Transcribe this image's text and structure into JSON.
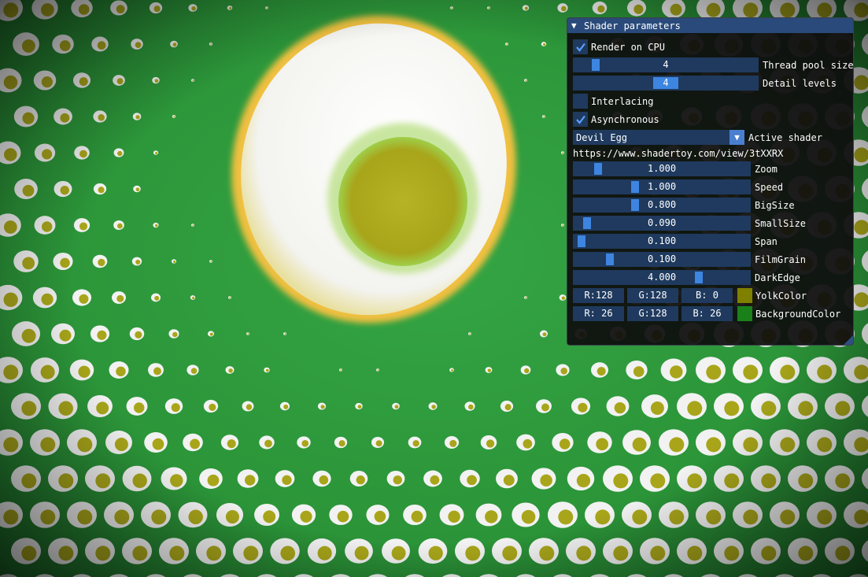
{
  "window": {
    "title": "Shader parameters",
    "collapse_icon": "triangle-down-icon"
  },
  "controls": {
    "render_cpu": {
      "label": "Render on CPU",
      "checked": true
    },
    "thread_pool": {
      "label": "Thread pool size",
      "value": "4",
      "fraction": 0.1
    },
    "detail_levels": {
      "label": "Detail levels",
      "value": "4",
      "fraction": 0.45
    },
    "interlacing": {
      "label": "Interlacing",
      "checked": false
    },
    "asynchronous": {
      "label": "Asynchronous",
      "checked": true
    },
    "active_shader": {
      "label": "Active shader",
      "value": "Devil Egg"
    },
    "url": "https://www.shadertoy.com/view/3tXXRX",
    "params": [
      {
        "label": "Zoom",
        "value": "1.000",
        "fraction": 0.12
      },
      {
        "label": "Speed",
        "value": "1.000",
        "fraction": 0.34
      },
      {
        "label": "BigSize",
        "value": "0.800",
        "fraction": 0.34
      },
      {
        "label": "SmallSize",
        "value": "0.090",
        "fraction": 0.05
      },
      {
        "label": "Span",
        "value": "0.100",
        "fraction": 0.02
      },
      {
        "label": "FilmGrain",
        "value": "0.100",
        "fraction": 0.19
      },
      {
        "label": "DarkEdge",
        "value": "4.000",
        "fraction": 0.72
      }
    ],
    "yolk_color": {
      "label": "YolkColor",
      "r": "R:128",
      "g": "G:128",
      "b": "B:  0",
      "swatch": "#808000"
    },
    "background_color": {
      "label": "BackgroundColor",
      "r": "R: 26",
      "g": "G:128",
      "b": "B: 26",
      "swatch": "#1a801a"
    }
  },
  "colors": {
    "background": "#2b9a3a",
    "egg_white": "#f2f2f2",
    "yolk": "#a8a51a",
    "accent": "#3d85e0"
  }
}
